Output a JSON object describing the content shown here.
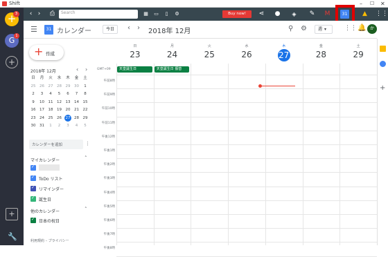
{
  "window": {
    "title": "Shift"
  },
  "shift_rail": {
    "badge1": "3",
    "avatar_letter": "G",
    "badge2": "1"
  },
  "toolbar": {
    "search_placeholder": "Search",
    "buy_now": "Buy now!",
    "highlight_color": "#e00000"
  },
  "header": {
    "app_name": "カレンダー",
    "today": "今日",
    "month_title": "2018年 12月",
    "view": "週",
    "avatar": "か"
  },
  "sidebar": {
    "create": "作成",
    "mini_month": "2018年 12月",
    "weekdays": [
      "日",
      "月",
      "火",
      "水",
      "木",
      "金",
      "土"
    ],
    "weeks": [
      [
        "25",
        "26",
        "27",
        "28",
        "29",
        "30",
        "1"
      ],
      [
        "2",
        "3",
        "4",
        "5",
        "6",
        "7",
        "8"
      ],
      [
        "9",
        "10",
        "11",
        "12",
        "13",
        "14",
        "15"
      ],
      [
        "16",
        "17",
        "18",
        "19",
        "20",
        "21",
        "22"
      ],
      [
        "23",
        "24",
        "25",
        "26",
        "27",
        "28",
        "29"
      ],
      [
        "30",
        "31",
        "1",
        "2",
        "3",
        "4",
        "5"
      ]
    ],
    "add_calendar": "カレンダーを追加",
    "my_calendars": "マイカレンダー",
    "calendars": [
      {
        "label": "",
        "color": "#4285f4"
      },
      {
        "label": "ToDo リスト",
        "color": "#4285f4"
      },
      {
        "label": "リマインダー",
        "color": "#3f51b5"
      },
      {
        "label": "誕生日",
        "color": "#33b679"
      }
    ],
    "other_calendars": "他のカレンダー",
    "other": [
      {
        "label": "日本の祝日",
        "color": "#0b8043"
      }
    ],
    "footer": "利用規約 – プライバシー"
  },
  "grid": {
    "timezone": "GMT+09",
    "days": [
      {
        "dow": "日",
        "date": "23"
      },
      {
        "dow": "月",
        "date": "24"
      },
      {
        "dow": "火",
        "date": "25"
      },
      {
        "dow": "水",
        "date": "26"
      },
      {
        "dow": "木",
        "date": "27",
        "today": true
      },
      {
        "dow": "金",
        "date": "28"
      },
      {
        "dow": "土",
        "date": "29"
      }
    ],
    "allday_events": [
      "天皇誕生日",
      "天皇誕生日 振替"
    ],
    "times": [
      "午前8時",
      "午前9時",
      "午前10時",
      "午前11時",
      "午後12時",
      "午後1時",
      "午後2時",
      "午後3時",
      "午後4時",
      "午後5時",
      "午後6時",
      "午後7時",
      "午後8時"
    ]
  }
}
